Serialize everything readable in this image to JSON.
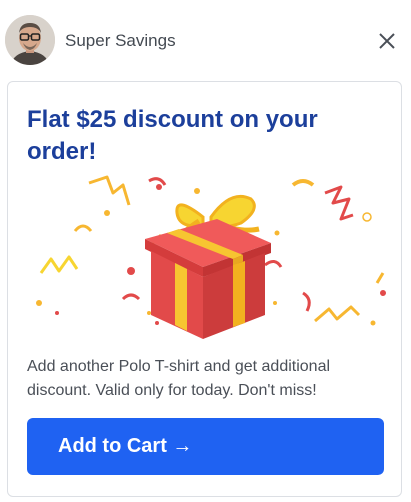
{
  "header": {
    "sender_name": "Super Savings",
    "avatar_icon": "person-avatar",
    "close_icon": "close-icon"
  },
  "card": {
    "title": "Flat $25 discount on your order!",
    "illustration": "gift-box-confetti-illustration",
    "description": "Add another Polo T-shirt and get additional discount. Valid only for today. Don't miss!",
    "cta_label": "Add to Cart →"
  },
  "colors": {
    "title": "#1c3f9b",
    "cta_background": "#1f62f2",
    "gift_red": "#e24a4a",
    "ribbon_yellow": "#f7c531"
  }
}
